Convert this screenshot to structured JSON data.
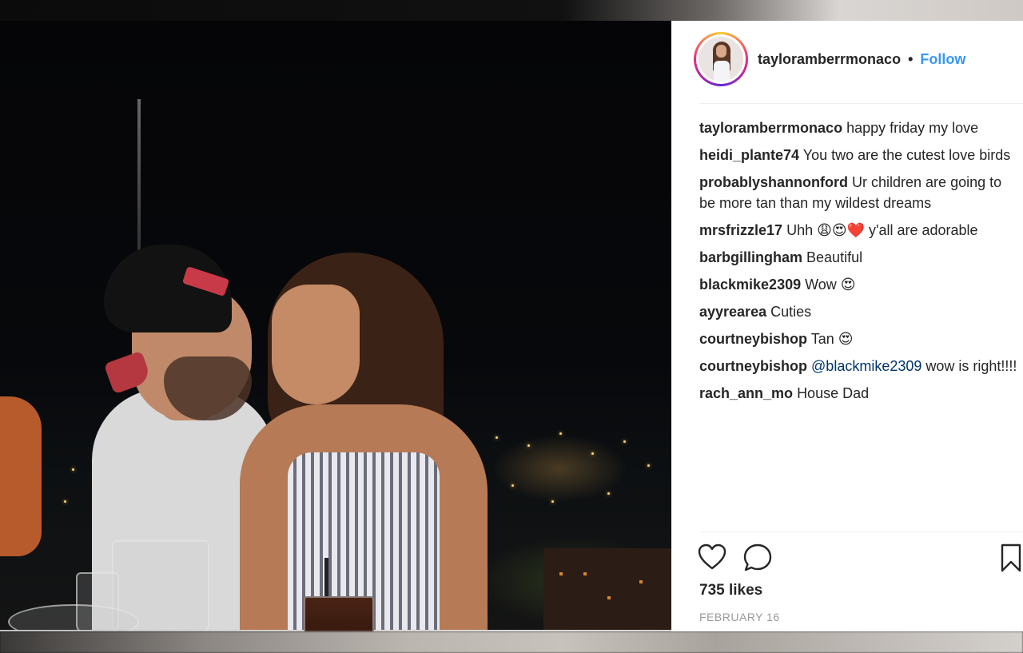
{
  "post": {
    "username": "tayloramberrmonaco",
    "follow_label": "Follow",
    "separator": "•",
    "likes": "735 likes",
    "date": "FEBRUARY 16"
  },
  "comments": [
    {
      "user": "tayloramberrmonaco",
      "text": "happy friday my love"
    },
    {
      "user": "heidi_plante74",
      "text": "You two are the cutest love birds"
    },
    {
      "user": "probablyshannonford",
      "text": "Ur children are going to be more tan than my wildest dreams"
    },
    {
      "user": "mrsfrizzle17",
      "text": "Uhh 😩😍❤️ y'all are adorable"
    },
    {
      "user": "barbgillingham",
      "text": "Beautiful"
    },
    {
      "user": "blackmike2309",
      "text": "Wow 😍"
    },
    {
      "user": "ayyrearea",
      "text": "Cuties"
    },
    {
      "user": "courtneybishop",
      "text": "Tan 😍"
    },
    {
      "user": "courtneybishop",
      "mention": "@blackmike2309",
      "text": "wow is right!!!!"
    },
    {
      "user": "rach_ann_mo",
      "text": "House Dad"
    }
  ],
  "icons": {
    "like": "heart-icon",
    "comment": "comment-bubble-icon",
    "save": "bookmark-icon"
  },
  "colors": {
    "follow": "#3897f0",
    "mention": "#003569",
    "text": "#262626",
    "muted": "#999999"
  }
}
